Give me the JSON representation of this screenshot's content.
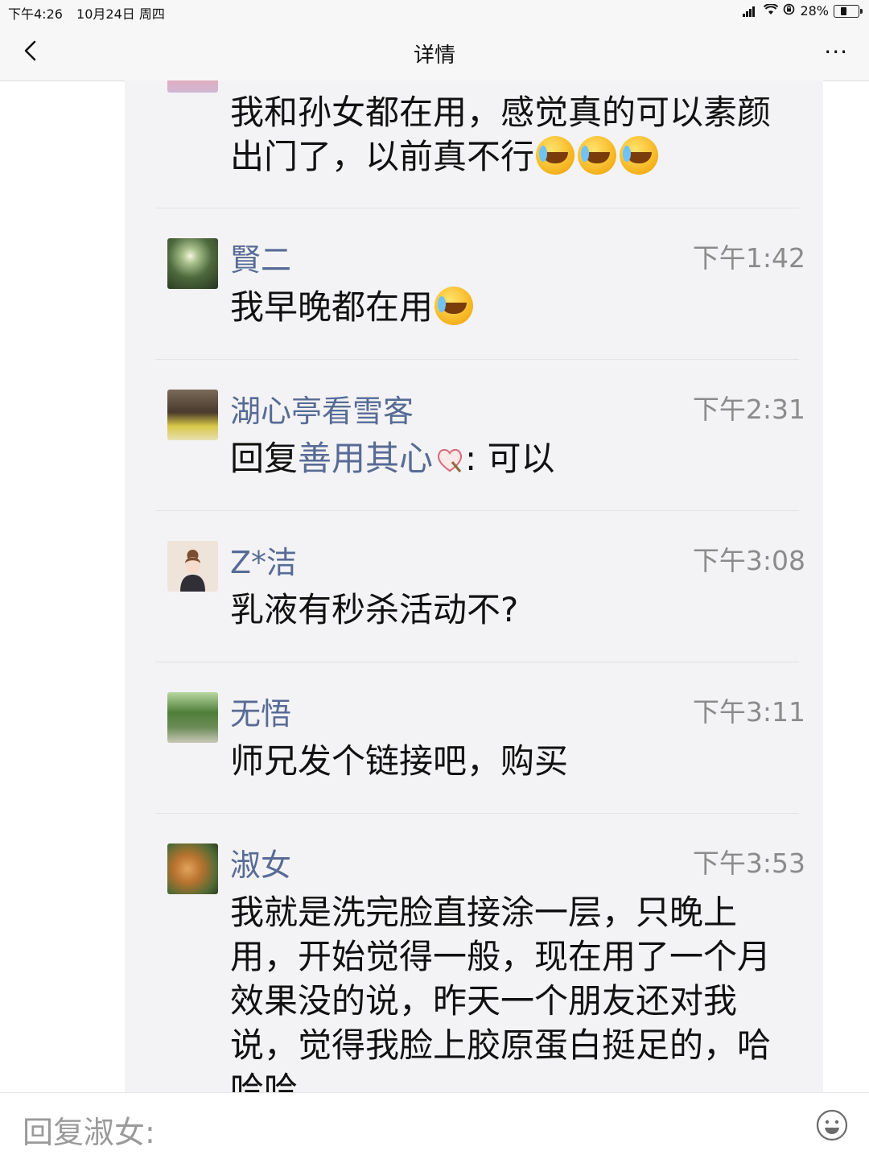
{
  "status_bar": {
    "time": "下午4:26",
    "date": "10月24日 周四",
    "battery": "28%",
    "battery_level": 0.28
  },
  "nav": {
    "title": "详情",
    "more": "···"
  },
  "comments": [
    {
      "name": "",
      "time": "",
      "text": "我和孙女都在用，感觉真的可以素颜出门了，以前真不行",
      "emoji_count": 3,
      "emoji": "crying-laughing-emoji"
    },
    {
      "name": "賢二",
      "time": "下午1:42",
      "text": "我早晚都在用",
      "emoji_count": 1,
      "emoji": "crying-laughing-emoji"
    },
    {
      "name": "湖心亭看雪客",
      "time": "下午2:31",
      "reply_prefix": "回复",
      "reply_to": "善用其心",
      "reply_suffix": ": 可以"
    },
    {
      "name": "Z*洁",
      "time": "下午3:08",
      "text": "乳液有秒杀活动不?"
    },
    {
      "name": "无悟",
      "time": "下午3:11",
      "text": "师兄发个链接吧，购买"
    },
    {
      "name": "淑女",
      "time": "下午3:53",
      "text": "我就是洗完脸直接涂一层，只晚上用，开始觉得一般，现在用了一个月效果没的说，昨天一个朋友还对我说，觉得我脸上胶原蛋白挺足的，哈哈哈"
    }
  ],
  "input": {
    "placeholder": "回复淑女:"
  }
}
